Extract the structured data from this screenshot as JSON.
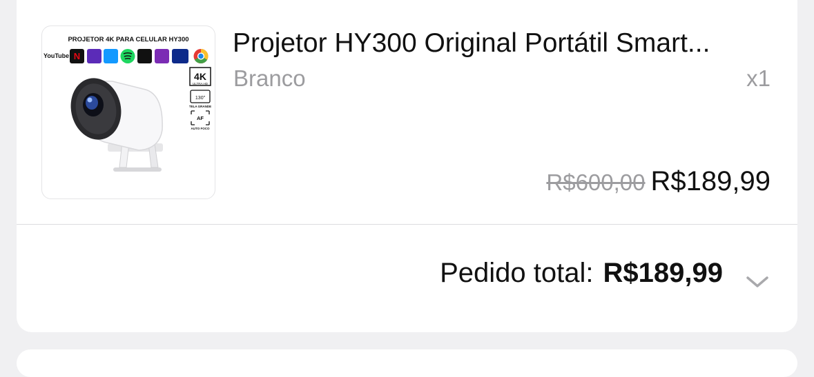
{
  "product": {
    "thumbnail": {
      "heading": "PROJETOR 4K PARA CELULAR HY300",
      "apps": [
        "YouTube",
        "Netflix",
        "HBO max",
        "prime video",
        "Spotify",
        "tv",
        "STAR+",
        "Disney+",
        "Chrome"
      ],
      "badges": [
        "4K",
        "ULTRA HD",
        "130\"",
        "TELA GRANDE",
        "AF",
        "AUTO FOCO"
      ]
    },
    "title": "Projetor  HY300 Original Portátil Smart...",
    "variant": "Branco",
    "quantity": "x1",
    "original_price": "R$600,00",
    "price": "R$189,99"
  },
  "order": {
    "total_label": "Pedido total:",
    "total_value": "R$189,99",
    "expand_icon": "chevron-down-icon"
  },
  "colors": {
    "background": "#f0f0f2",
    "card": "#ffffff",
    "text": "#111111",
    "muted": "#9c9c9f"
  }
}
